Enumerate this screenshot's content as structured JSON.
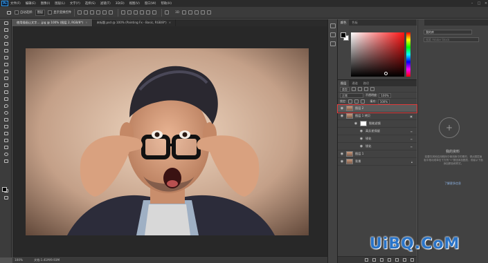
{
  "app": {
    "logo_text": "Ps"
  },
  "menubar": {
    "items": [
      "文件(F)",
      "编辑(E)",
      "图像(I)",
      "图层(L)",
      "文字(Y)",
      "选择(S)",
      "滤镜(T)",
      "3D(D)",
      "视图(V)",
      "窗口(W)",
      "帮助(H)"
    ]
  },
  "options": {
    "auto_select_label": "自动选择:",
    "auto_select_target": "图层",
    "show_transform_label": "显示变换控件"
  },
  "tabs": [
    {
      "label": "使用插画让文字... .jpg @ 100% (图层 2, RGB/8*)",
      "active": true
    },
    {
      "label": "未标题.psd @ 100% (Painting Fx - Basic, RGB/8*)",
      "active": false
    }
  ],
  "status": {
    "zoom": "100%",
    "doc_info": "文档:1.41M/9.93M"
  },
  "color_panel": {
    "tabs": [
      "颜色",
      "色板"
    ],
    "fg_color": "#000000",
    "bg_color": "#ffffff"
  },
  "layers_panel": {
    "tabs": [
      "图层",
      "通道",
      "路径"
    ],
    "filter_label": "类型",
    "blend_mode": "正常",
    "opacity_label": "不透明度:",
    "opacity_value": "100%",
    "fill_label": "填充:",
    "fill_value": "100%",
    "lock_label": "锁定:",
    "layers": [
      {
        "name": "图层 2",
        "selected": true
      },
      {
        "name": "图层 1 拷贝",
        "selected": false
      },
      {
        "name": "智能滤镜",
        "selected": false
      },
      {
        "name": "高反差保留",
        "selected": false
      },
      {
        "name": "锐化",
        "selected": false
      },
      {
        "name": "锐化",
        "selected": false
      },
      {
        "name": "图层 1",
        "selected": false
      },
      {
        "name": "背景",
        "selected": false
      }
    ]
  },
  "libraries": {
    "dropdown": "我的库",
    "search_placeholder": "搜索 Adobe Stock",
    "title": "我的资料",
    "body": "若要在其他应用程序中使用库中的素材，请从图层面板中拖动或单击下方的\"+\"按钮添加图层，或者从下面添加颜色和样式。",
    "link": "了解更多信息"
  },
  "watermark": {
    "text": "UiBQ.CoM"
  }
}
